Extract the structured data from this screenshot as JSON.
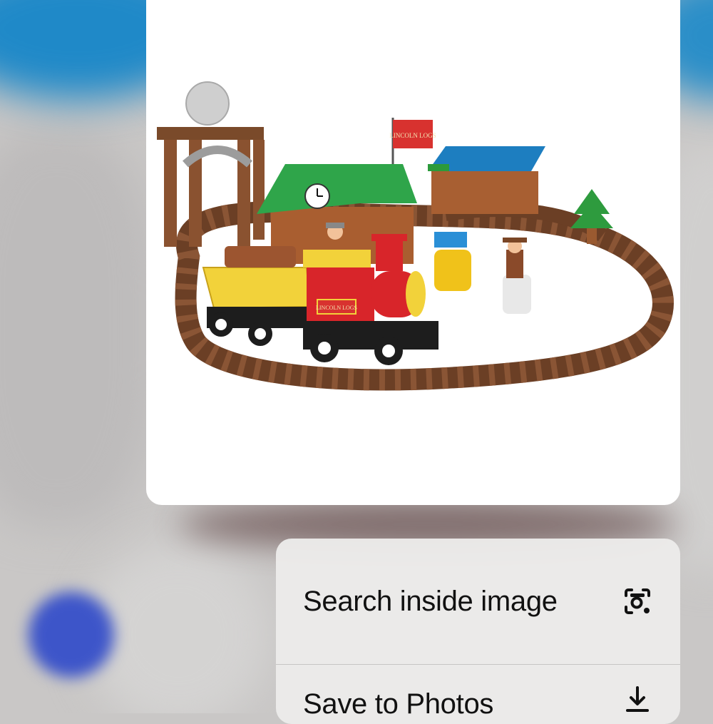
{
  "background": {
    "accent": "#1f89c8",
    "dot": "#3d55c9"
  },
  "preview": {
    "flag_text": "LINCOLN LOGS",
    "engine_plate_text": "LINCOLN LOGS"
  },
  "menu": {
    "items": [
      {
        "label": "Search inside image",
        "icon": "lens-search-icon"
      },
      {
        "label": "Save to Photos",
        "icon": "download-icon"
      }
    ]
  }
}
